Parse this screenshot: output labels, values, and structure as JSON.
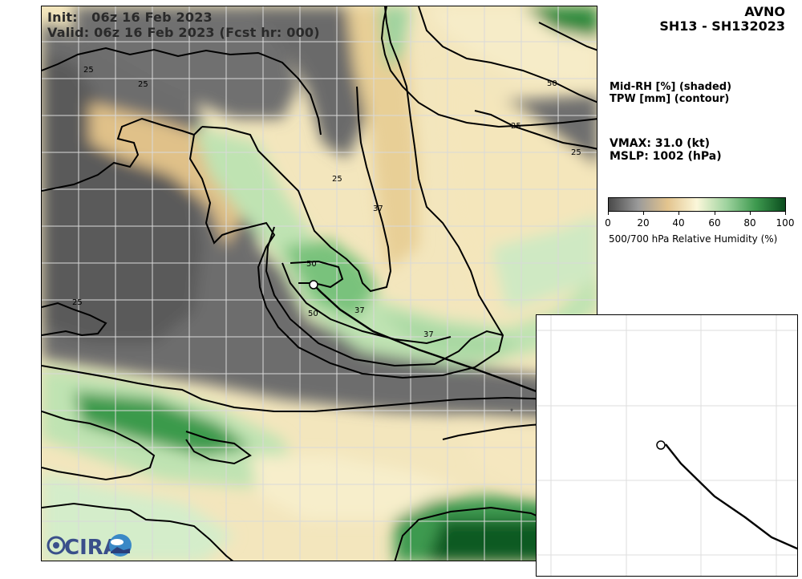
{
  "header": {
    "init": "Init:   06z 16 Feb 2023",
    "valid": "Valid: 06z 16 Feb 2023 (Fcst hr: 000)"
  },
  "title": {
    "model": "AVNO",
    "storm": "SH13 - SH132023"
  },
  "legend": {
    "shading": "Mid-RH [%] (shaded)",
    "contour": "TPW [mm] (contour)"
  },
  "stats": {
    "vmax": "VMAX:  31.0 (kt)",
    "mslp": "MSLP: 1002 (hPa)"
  },
  "colorbar": {
    "ticks": [
      "0",
      "20",
      "40",
      "60",
      "80",
      "100"
    ],
    "label": "500/700 hPa Relative Humidity (%)",
    "range": [
      0,
      100
    ],
    "colors": [
      "#4a4a4a",
      "#9a9a9a",
      "#e3c48e",
      "#fbf7da",
      "#9fd39f",
      "#3e9a4f",
      "#0b4d1e"
    ]
  },
  "contour_labels": [
    "25",
    "25",
    "25",
    "25",
    "50",
    "25",
    "25",
    "37",
    "50",
    "50",
    "37",
    "37",
    "25"
  ],
  "logo": {
    "name": "CIRA",
    "icon": "cira-logo"
  },
  "colors": {
    "track": "#000000",
    "dry": "#5b5b5b",
    "moist": "#2f8a3e",
    "tan": "#e3c48e"
  }
}
